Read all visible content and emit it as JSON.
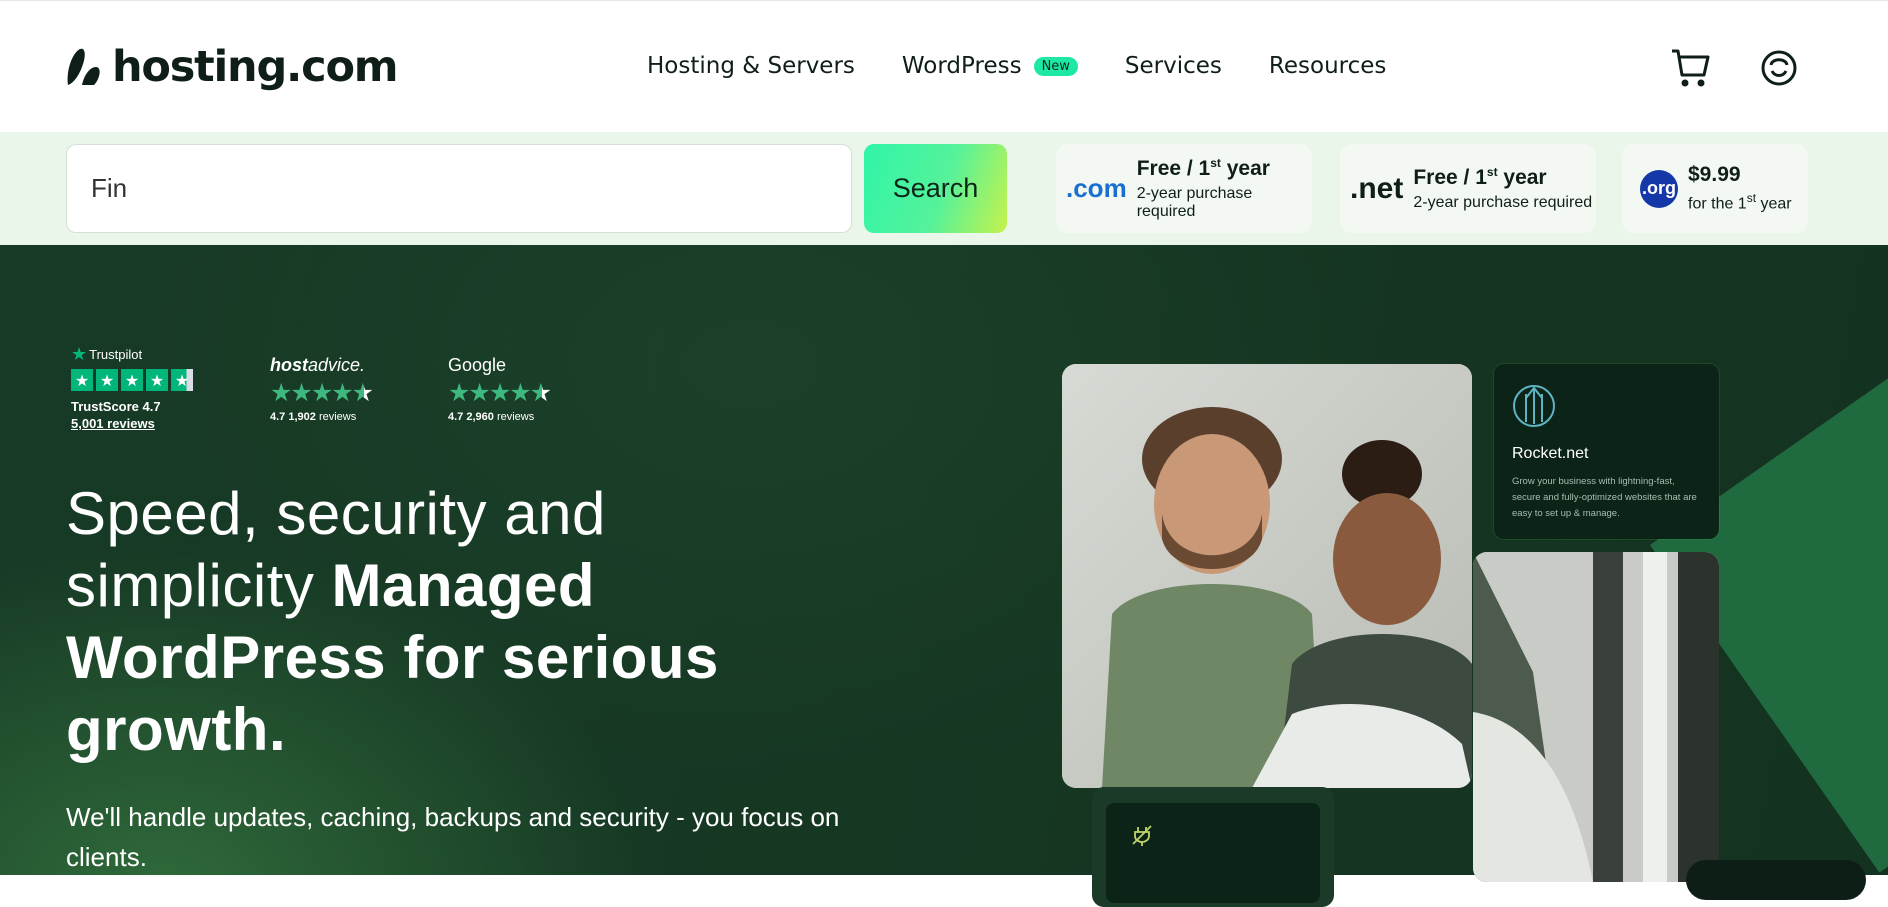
{
  "brand": {
    "name": "hosting.com"
  },
  "nav": {
    "items": [
      {
        "label": "Hosting & Servers"
      },
      {
        "label": "WordPress",
        "badge": "New"
      },
      {
        "label": "Services"
      },
      {
        "label": "Resources"
      }
    ],
    "icons": [
      "cart-icon",
      "user-icon"
    ]
  },
  "search": {
    "value": "Fin",
    "button_label": "Search"
  },
  "tlds": [
    {
      "mark": ".com",
      "title_main": "Free / 1",
      "title_sup": "st",
      "title_end": " year",
      "subtitle": "2-year purchase required",
      "mark_color": "#1a6fd1"
    },
    {
      "mark": ".net",
      "title_main": "Free / 1",
      "title_sup": "st",
      "title_end": " year",
      "subtitle": "2-year purchase required",
      "mark_color": "#0f1f17"
    },
    {
      "mark": ".org",
      "title_main": "$9.99",
      "subtitle_main": "for the 1",
      "subtitle_sup": "st",
      "subtitle_end": " year",
      "mark_color": "#1538a8"
    }
  ],
  "reviews": {
    "trustpilot": {
      "name": "Trustpilot",
      "score_label": "TrustScore 4.7",
      "reviews_link": "5,001 reviews",
      "rating": 4.7
    },
    "hostadvice": {
      "name_a": "host",
      "name_b": "advice.",
      "rating_text": "4.7",
      "count": "1,902",
      "suffix": "reviews",
      "rating": 4.7
    },
    "google": {
      "name": "Google",
      "rating_text": "4.7",
      "count": "2,960",
      "suffix": "reviews",
      "rating": 4.7
    }
  },
  "hero": {
    "headline_regular": "Speed, security and simplicity ",
    "headline_bold": "Managed WordPress for serious growth.",
    "subheadline": "We'll handle updates, caching, backups and security - you focus on clients."
  },
  "cards": {
    "rocket": {
      "title": "Rocket.net",
      "description": "Grow your business with lightning-fast, secure and fully-optimized websites that are easy to set up & manage."
    }
  },
  "colors": {
    "accent": "#1de9a4",
    "hero_bg": "#163823",
    "search_band": "#eaf6e9",
    "trustpilot_green": "#00b67a"
  }
}
